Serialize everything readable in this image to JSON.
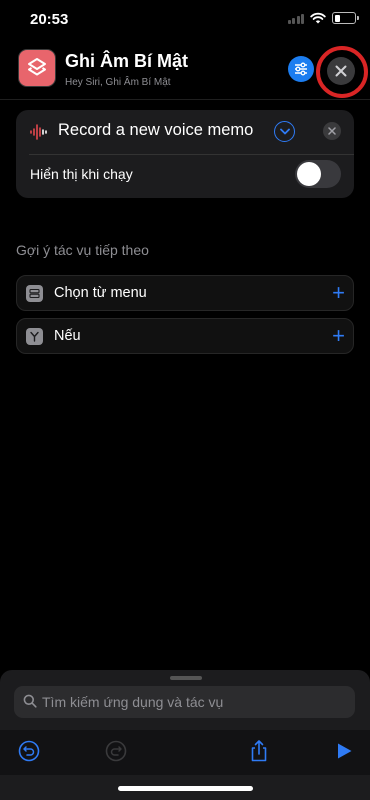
{
  "status_bar": {
    "time": "20:53"
  },
  "header": {
    "title": "Ghi Âm Bí Mật",
    "subtitle": "Hey Siri, Ghi Âm Bí Mật",
    "app_icon": "shortcuts-icon",
    "accent_color": "#e8656c"
  },
  "action": {
    "label": "Record a new voice memo",
    "icon": "waveform-icon",
    "show_when_run_label": "Hiển thị khi chạy",
    "show_when_run_on": false
  },
  "suggestions": {
    "header": "Gợi ý tác vụ tiếp theo",
    "items": [
      {
        "label": "Chọn từ menu",
        "icon": "menu-icon"
      },
      {
        "label": "Nếu",
        "icon": "branch-icon"
      }
    ]
  },
  "search": {
    "placeholder": "Tìm kiếm ứng dụng và tác vụ"
  },
  "colors": {
    "accent": "#2f7bf5",
    "highlight_ring": "#d92525"
  }
}
